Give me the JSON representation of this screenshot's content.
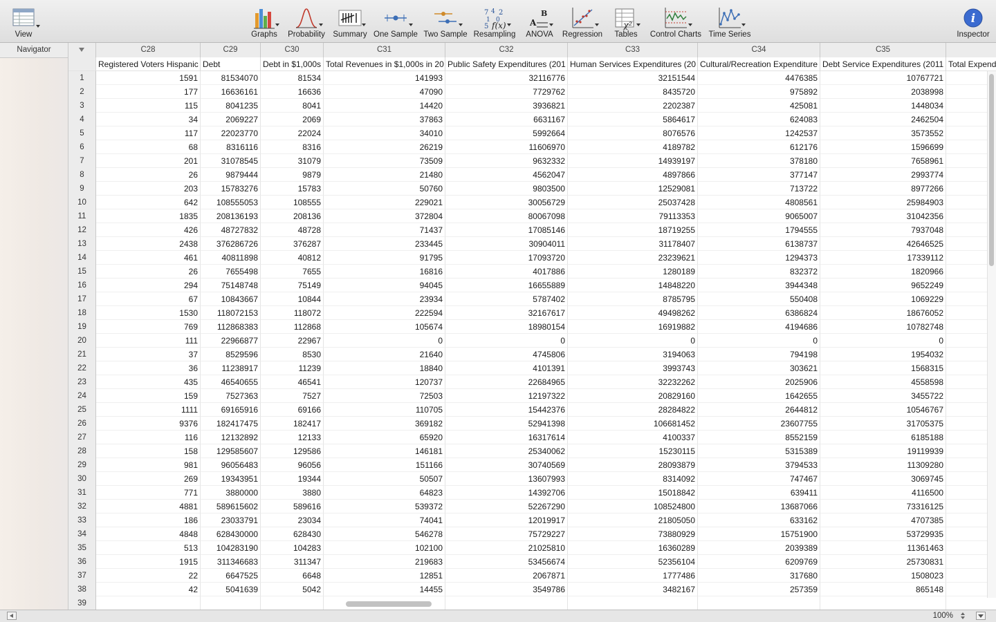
{
  "toolbar": {
    "view": "View",
    "graphs": "Graphs",
    "probability": "Probability",
    "summary": "Summary",
    "one_sample": "One Sample",
    "two_sample": "Two Sample",
    "resampling": "Resampling",
    "anova": "ANOVA",
    "regression": "Regression",
    "tables": "Tables",
    "control_charts": "Control Charts",
    "time_series": "Time Series",
    "inspector": "Inspector"
  },
  "navigator": {
    "title": "Navigator"
  },
  "columns": [
    "C28",
    "C29",
    "C30",
    "C31",
    "C32",
    "C33",
    "C34",
    "C35"
  ],
  "column_names": [
    "Registered Voters Hispanic",
    "Debt",
    "Debt in $1,000s",
    "Total Revenues in $1,000s in 20",
    "Public Safety Expenditures (201",
    "Human Services Expenditures (20",
    "Cultural/Recreation Expenditure",
    "Debt Service Expenditures (2011",
    "Total Expend"
  ],
  "row_numbers": [
    "1",
    "2",
    "3",
    "4",
    "5",
    "6",
    "7",
    "8",
    "9",
    "10",
    "11",
    "12",
    "13",
    "14",
    "15",
    "16",
    "17",
    "18",
    "19",
    "20",
    "21",
    "22",
    "23",
    "24",
    "25",
    "26",
    "27",
    "28",
    "29",
    "30",
    "31",
    "32",
    "33",
    "34",
    "35",
    "36",
    "37",
    "38",
    "39"
  ],
  "rows": [
    [
      "1591",
      "81534070",
      "81534",
      "141993",
      "32116776",
      "32151544",
      "4476385",
      "10767721"
    ],
    [
      "177",
      "16636161",
      "16636",
      "47090",
      "7729762",
      "8435720",
      "975892",
      "2038998"
    ],
    [
      "115",
      "8041235",
      "8041",
      "14420",
      "3936821",
      "2202387",
      "425081",
      "1448034"
    ],
    [
      "34",
      "2069227",
      "2069",
      "37863",
      "6631167",
      "5864617",
      "624083",
      "2462504"
    ],
    [
      "117",
      "22023770",
      "22024",
      "34010",
      "5992664",
      "8076576",
      "1242537",
      "3573552"
    ],
    [
      "68",
      "8316116",
      "8316",
      "26219",
      "11606970",
      "4189782",
      "612176",
      "1596699"
    ],
    [
      "201",
      "31078545",
      "31079",
      "73509",
      "9632332",
      "14939197",
      "378180",
      "7658961"
    ],
    [
      "26",
      "9879444",
      "9879",
      "21480",
      "4562047",
      "4897866",
      "377147",
      "2993774"
    ],
    [
      "203",
      "15783276",
      "15783",
      "50760",
      "9803500",
      "12529081",
      "713722",
      "8977266"
    ],
    [
      "642",
      "108555053",
      "108555",
      "229021",
      "30056729",
      "25037428",
      "4808561",
      "25984903"
    ],
    [
      "1835",
      "208136193",
      "208136",
      "372804",
      "80067098",
      "79113353",
      "9065007",
      "31042356"
    ],
    [
      "426",
      "48727832",
      "48728",
      "71437",
      "17085146",
      "18719255",
      "1794555",
      "7937048"
    ],
    [
      "2438",
      "376286726",
      "376287",
      "233445",
      "30904011",
      "31178407",
      "6138737",
      "42646525"
    ],
    [
      "461",
      "40811898",
      "40812",
      "91795",
      "17093720",
      "23239621",
      "1294373",
      "17339112"
    ],
    [
      "26",
      "7655498",
      "7655",
      "16816",
      "4017886",
      "1280189",
      "832372",
      "1820966"
    ],
    [
      "294",
      "75148748",
      "75149",
      "94045",
      "16655889",
      "14848220",
      "3944348",
      "9652249"
    ],
    [
      "67",
      "10843667",
      "10844",
      "23934",
      "5787402",
      "8785795",
      "550408",
      "1069229"
    ],
    [
      "1530",
      "118072153",
      "118072",
      "222594",
      "32167617",
      "49498262",
      "6386824",
      "18676052"
    ],
    [
      "769",
      "112868383",
      "112868",
      "105674",
      "18980154",
      "16919882",
      "4194686",
      "10782748"
    ],
    [
      "111",
      "22966877",
      "22967",
      "0",
      "0",
      "0",
      "0",
      "0"
    ],
    [
      "37",
      "8529596",
      "8530",
      "21640",
      "4745806",
      "3194063",
      "794198",
      "1954032"
    ],
    [
      "36",
      "11238917",
      "11239",
      "18840",
      "4101391",
      "3993743",
      "303621",
      "1568315"
    ],
    [
      "435",
      "46540655",
      "46541",
      "120737",
      "22684965",
      "32232262",
      "2025906",
      "4558598"
    ],
    [
      "159",
      "7527363",
      "7527",
      "72503",
      "12197322",
      "20829160",
      "1642655",
      "3455722"
    ],
    [
      "1111",
      "69165916",
      "69166",
      "110705",
      "15442376",
      "28284822",
      "2644812",
      "10546767"
    ],
    [
      "9376",
      "182417475",
      "182417",
      "369182",
      "52941398",
      "106681452",
      "23607755",
      "31705375"
    ],
    [
      "116",
      "12132892",
      "12133",
      "65920",
      "16317614",
      "4100337",
      "8552159",
      "6185188"
    ],
    [
      "158",
      "129585607",
      "129586",
      "146181",
      "25340062",
      "15230115",
      "5315389",
      "19119939"
    ],
    [
      "981",
      "96056483",
      "96056",
      "151166",
      "30740569",
      "28093879",
      "3794533",
      "11309280"
    ],
    [
      "269",
      "19343951",
      "19344",
      "50507",
      "13607993",
      "8314092",
      "747467",
      "3069745"
    ],
    [
      "771",
      "3880000",
      "3880",
      "64823",
      "14392706",
      "15018842",
      "639411",
      "4116500"
    ],
    [
      "4881",
      "589615602",
      "589616",
      "539372",
      "52267290",
      "108524800",
      "13687066",
      "73316125"
    ],
    [
      "186",
      "23033791",
      "23034",
      "74041",
      "12019917",
      "21805050",
      "633162",
      "4707385"
    ],
    [
      "4848",
      "628430000",
      "628430",
      "546278",
      "75729227",
      "73880929",
      "15751900",
      "53729935"
    ],
    [
      "513",
      "104283190",
      "104283",
      "102100",
      "21025810",
      "16360289",
      "2039389",
      "11361463"
    ],
    [
      "1915",
      "311346683",
      "311347",
      "219683",
      "53456674",
      "52356104",
      "6209769",
      "25730831"
    ],
    [
      "22",
      "6647525",
      "6648",
      "12851",
      "2067871",
      "1777486",
      "317680",
      "1508023"
    ],
    [
      "42",
      "5041639",
      "5042",
      "14455",
      "3549786",
      "3482167",
      "257359",
      "865148"
    ],
    [
      "",
      "",
      "",
      "",
      "",
      "",
      "",
      ""
    ]
  ],
  "status": {
    "zoom": "100%"
  }
}
